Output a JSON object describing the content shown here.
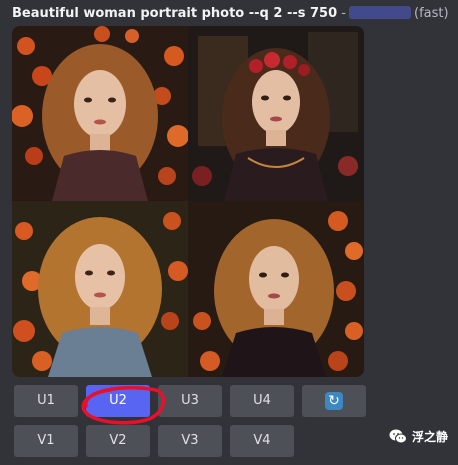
{
  "message": {
    "prompt": "Beautiful woman portrait photo --q 2 --s 750",
    "separator": "-",
    "speed": "(fast)"
  },
  "images": [
    {
      "name": "image-1"
    },
    {
      "name": "image-2"
    },
    {
      "name": "image-3"
    },
    {
      "name": "image-4"
    }
  ],
  "buttons": {
    "upscale": [
      "U1",
      "U2",
      "U3",
      "U4"
    ],
    "variation": [
      "V1",
      "V2",
      "V3",
      "V4"
    ],
    "reroll_icon": "refresh-icon",
    "active": "U2"
  },
  "colors": {
    "background": "#313338",
    "button": "#4e5058",
    "button_active": "#5865f2",
    "annotation": "#e8102a"
  },
  "watermark": {
    "text": "浮之静",
    "icon": "wechat-icon"
  }
}
